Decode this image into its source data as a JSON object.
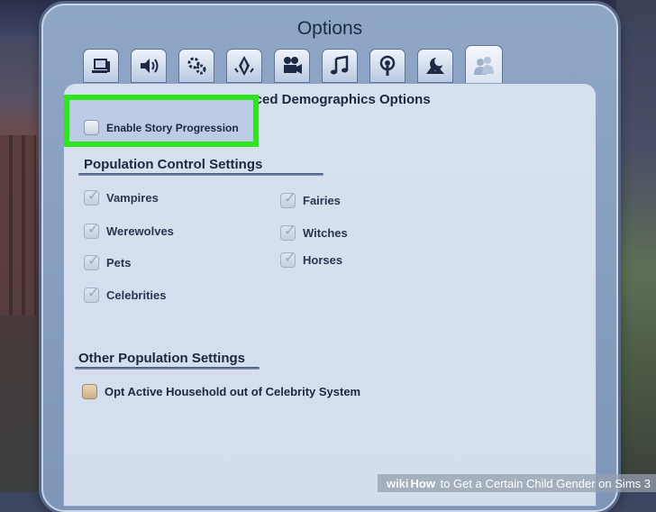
{
  "dialog": {
    "title": "Options"
  },
  "tabs": [
    {
      "icon": "graphics-icon",
      "active": false
    },
    {
      "icon": "sound-icon",
      "active": false
    },
    {
      "icon": "gear-icon",
      "active": false
    },
    {
      "icon": "plumbob-icon",
      "active": false
    },
    {
      "icon": "video-camera-icon",
      "active": false
    },
    {
      "icon": "music-note-icon",
      "active": false
    },
    {
      "icon": "broadcast-icon",
      "active": false
    },
    {
      "icon": "night-scene-icon",
      "active": false
    },
    {
      "icon": "people-icon",
      "active": true
    }
  ],
  "panel": {
    "title": "Advanced Demographics Options",
    "title_visible_fragment": "ced Demographics Options",
    "story_progression": {
      "label": "Enable Story Progression",
      "checked": false
    }
  },
  "population_control": {
    "header": "Population Control Settings",
    "items": [
      {
        "label": "Vampires",
        "checked": true
      },
      {
        "label": "Werewolves",
        "checked": true
      },
      {
        "label": "Pets",
        "checked": true
      },
      {
        "label": "Celebrities",
        "checked": true
      },
      {
        "label": "Fairies",
        "checked": true
      },
      {
        "label": "Witches",
        "checked": true
      },
      {
        "label": "Horses",
        "checked": true
      }
    ]
  },
  "other_population": {
    "header": "Other Population Settings",
    "opt_out": {
      "label": "Opt Active Household out of Celebrity System",
      "checked": false
    }
  },
  "watermark": {
    "brand": "wiki",
    "how": "How",
    "text": " to Get a Certain Child Gender on Sims 3"
  },
  "colors": {
    "highlight": "#2fe61e",
    "panel": "#d6e0ef",
    "dialog": "#8fa6c6"
  }
}
